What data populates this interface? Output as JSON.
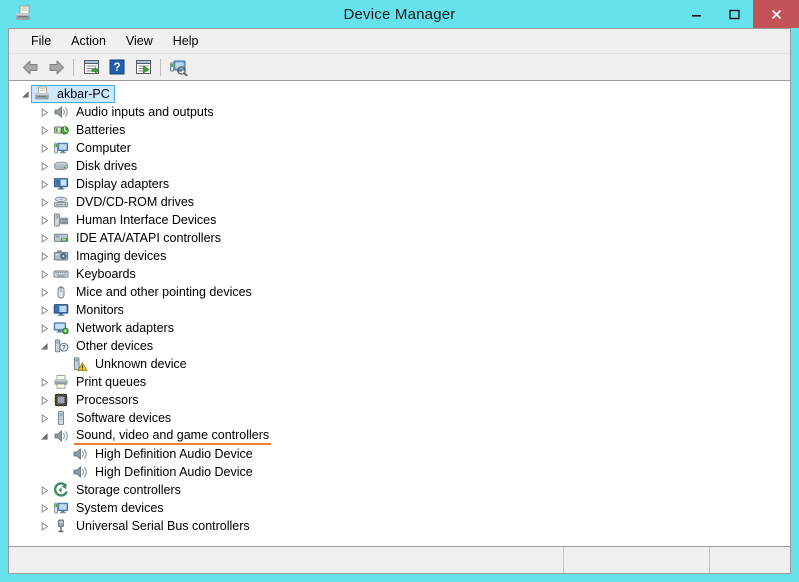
{
  "window": {
    "title": "Device Manager",
    "icon": "device-manager-icon",
    "frame_color": "#66E2EC",
    "close_button_color": "#C35356"
  },
  "controls": {
    "minimize_label": "Minimize",
    "maximize_label": "Maximize",
    "close_label": "Close"
  },
  "menubar": {
    "items": [
      {
        "label": "File"
      },
      {
        "label": "Action"
      },
      {
        "label": "View"
      },
      {
        "label": "Help"
      }
    ]
  },
  "toolbar": {
    "buttons": [
      {
        "name": "back-icon",
        "label": "Back"
      },
      {
        "name": "forward-icon",
        "label": "Forward"
      },
      {
        "name": "separator",
        "label": ""
      },
      {
        "name": "properties-icon",
        "label": "Properties"
      },
      {
        "name": "help-icon",
        "label": "Help"
      },
      {
        "name": "show-hidden-devices-icon",
        "label": "Show hidden devices"
      },
      {
        "name": "separator",
        "label": ""
      },
      {
        "name": "scan-for-hardware-changes-icon",
        "label": "Scan for hardware changes"
      }
    ]
  },
  "tree": {
    "accent_underline_color": "#ED7D31",
    "selection_fill": "#CCE8FF",
    "selection_border": "#4FA8E8",
    "nodes": [
      {
        "label": "akbar-PC",
        "icon": "computer-device-icon",
        "depth": 0,
        "state": "expanded",
        "selected": true,
        "underlined": false
      },
      {
        "label": "Audio inputs and outputs",
        "icon": "speaker-icon",
        "depth": 1,
        "state": "collapsed",
        "selected": false,
        "underlined": false
      },
      {
        "label": "Batteries",
        "icon": "battery-icon",
        "depth": 1,
        "state": "collapsed",
        "selected": false,
        "underlined": false
      },
      {
        "label": "Computer",
        "icon": "monitor-icon",
        "depth": 1,
        "state": "collapsed",
        "selected": false,
        "underlined": false
      },
      {
        "label": "Disk drives",
        "icon": "disk-drive-icon",
        "depth": 1,
        "state": "collapsed",
        "selected": false,
        "underlined": false
      },
      {
        "label": "Display adapters",
        "icon": "display-adapter-icon",
        "depth": 1,
        "state": "collapsed",
        "selected": false,
        "underlined": false
      },
      {
        "label": "DVD/CD-ROM drives",
        "icon": "optical-drive-icon",
        "depth": 1,
        "state": "collapsed",
        "selected": false,
        "underlined": false
      },
      {
        "label": "Human Interface Devices",
        "icon": "hid-icon",
        "depth": 1,
        "state": "collapsed",
        "selected": false,
        "underlined": false
      },
      {
        "label": "IDE ATA/ATAPI controllers",
        "icon": "ide-controller-icon",
        "depth": 1,
        "state": "collapsed",
        "selected": false,
        "underlined": false
      },
      {
        "label": "Imaging devices",
        "icon": "camera-icon",
        "depth": 1,
        "state": "collapsed",
        "selected": false,
        "underlined": false
      },
      {
        "label": "Keyboards",
        "icon": "keyboard-icon",
        "depth": 1,
        "state": "collapsed",
        "selected": false,
        "underlined": false
      },
      {
        "label": "Mice and other pointing devices",
        "icon": "mouse-icon",
        "depth": 1,
        "state": "collapsed",
        "selected": false,
        "underlined": false
      },
      {
        "label": "Monitors",
        "icon": "monitor-screen-icon",
        "depth": 1,
        "state": "collapsed",
        "selected": false,
        "underlined": false
      },
      {
        "label": "Network adapters",
        "icon": "network-adapter-icon",
        "depth": 1,
        "state": "collapsed",
        "selected": false,
        "underlined": false
      },
      {
        "label": "Other devices",
        "icon": "other-device-icon",
        "depth": 1,
        "state": "expanded",
        "selected": false,
        "underlined": false
      },
      {
        "label": "Unknown device",
        "icon": "unknown-device-warning-icon",
        "depth": 2,
        "state": "leaf",
        "selected": false,
        "underlined": false
      },
      {
        "label": "Print queues",
        "icon": "printer-icon",
        "depth": 1,
        "state": "collapsed",
        "selected": false,
        "underlined": false
      },
      {
        "label": "Processors",
        "icon": "processor-icon",
        "depth": 1,
        "state": "collapsed",
        "selected": false,
        "underlined": false
      },
      {
        "label": "Software devices",
        "icon": "software-device-icon",
        "depth": 1,
        "state": "collapsed",
        "selected": false,
        "underlined": false
      },
      {
        "label": "Sound, video and game controllers",
        "icon": "speaker-icon",
        "depth": 1,
        "state": "expanded",
        "selected": false,
        "underlined": true
      },
      {
        "label": "High Definition Audio Device",
        "icon": "speaker-icon",
        "depth": 2,
        "state": "leaf",
        "selected": false,
        "underlined": false
      },
      {
        "label": "High Definition Audio Device",
        "icon": "speaker-icon",
        "depth": 2,
        "state": "leaf",
        "selected": false,
        "underlined": false
      },
      {
        "label": "Storage controllers",
        "icon": "storage-controller-icon",
        "depth": 1,
        "state": "collapsed",
        "selected": false,
        "underlined": false
      },
      {
        "label": "System devices",
        "icon": "monitor-icon",
        "depth": 1,
        "state": "collapsed",
        "selected": false,
        "underlined": false
      },
      {
        "label": "Universal Serial Bus controllers",
        "icon": "usb-icon",
        "depth": 1,
        "state": "collapsed",
        "selected": false,
        "underlined": false
      }
    ]
  },
  "statusbar": {
    "main_text": "",
    "cell1_text": "",
    "cell2_text": ""
  }
}
